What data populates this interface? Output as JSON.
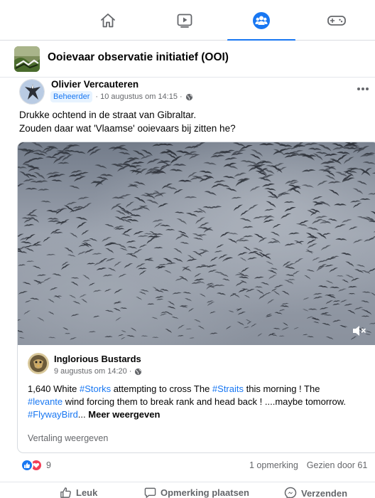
{
  "nav": {
    "tabs": [
      {
        "name": "home",
        "icon": "home-icon",
        "active": false
      },
      {
        "name": "video",
        "icon": "video-icon",
        "active": false
      },
      {
        "name": "groups",
        "icon": "groups-icon",
        "active": true
      },
      {
        "name": "gaming",
        "icon": "gaming-icon",
        "active": false
      }
    ],
    "accent_color": "#1877f2"
  },
  "group": {
    "name": "Ooievaar observatie initiatief (OOI)"
  },
  "post": {
    "author": "Olivier Vercauteren",
    "badge": "Beheerder",
    "date": "10 augustus om 14:15",
    "privacy_icon": "globe-icon",
    "text_line1": "Drukke ochtend in de straat van Gibraltar.",
    "text_line2": "Zouden daar wat 'Vlaamse' ooievaars bij zitten he?"
  },
  "shared": {
    "author": "Inglorious Bustards",
    "date": "9 augustus om 14:20",
    "privacy_icon": "globe-icon",
    "text_a": "1,640 White ",
    "tag_storks": "#Storks",
    "text_b": " attempting to cross The ",
    "tag_straits": "#Straits",
    "text_c": " this morning ! The",
    "tag_levante": "#levante",
    "text_d": " wind forcing them to break rank and head back ! ....maybe tomorrow.",
    "tag_flyway": "#FlywayBird",
    "ellipsis": "...",
    "see_more": "Meer weergeven",
    "translate": "Vertaling weergeven",
    "video_muted": true
  },
  "stats": {
    "reaction_count": "9",
    "comments": "1 opmerking",
    "views": "Gezien door 61"
  },
  "actions": {
    "like": "Leuk",
    "comment": "Opmerking plaatsen",
    "share": "Verzenden"
  }
}
